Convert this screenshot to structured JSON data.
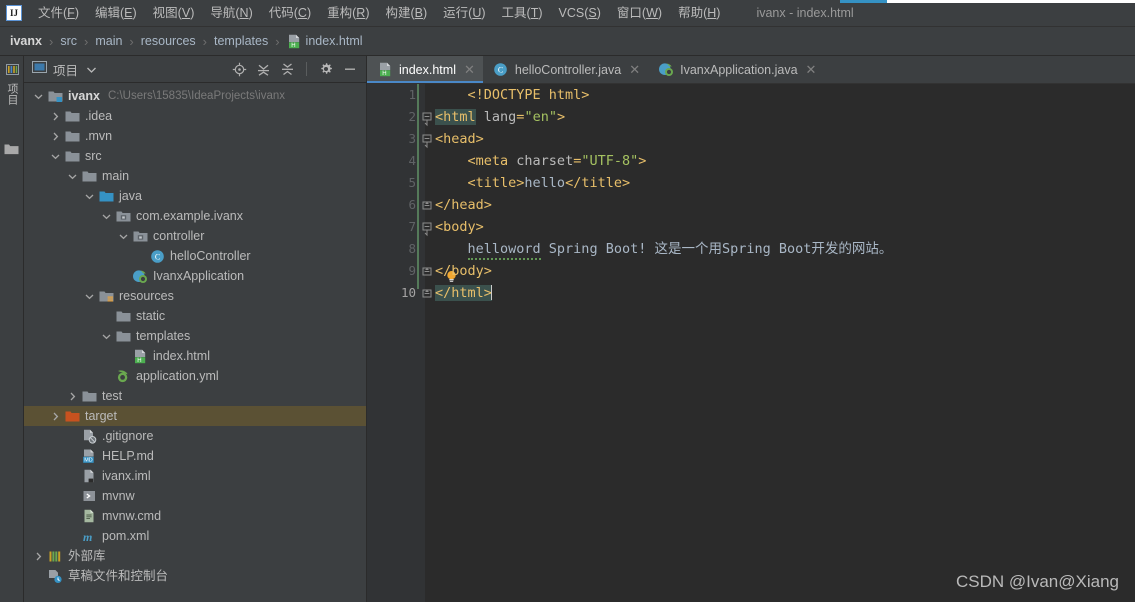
{
  "window": {
    "title": "ivanx - index.html",
    "logo_icon": "intellij-idea-logo-icon"
  },
  "menubar": {
    "items": [
      {
        "label": "文件",
        "mnemonic": "F"
      },
      {
        "label": "编辑",
        "mnemonic": "E"
      },
      {
        "label": "视图",
        "mnemonic": "V"
      },
      {
        "label": "导航",
        "mnemonic": "N"
      },
      {
        "label": "代码",
        "mnemonic": "C"
      },
      {
        "label": "重构",
        "mnemonic": "R"
      },
      {
        "label": "构建",
        "mnemonic": "B"
      },
      {
        "label": "运行",
        "mnemonic": "U"
      },
      {
        "label": "工具",
        "mnemonic": "T"
      },
      {
        "label": "VCS",
        "mnemonic": "S"
      },
      {
        "label": "窗口",
        "mnemonic": "W"
      },
      {
        "label": "帮助",
        "mnemonic": "H"
      }
    ]
  },
  "breadcrumb": {
    "separator": "›",
    "items": [
      {
        "label": "ivanx",
        "icon": ""
      },
      {
        "label": "src",
        "icon": ""
      },
      {
        "label": "main",
        "icon": ""
      },
      {
        "label": "resources",
        "icon": ""
      },
      {
        "label": "templates",
        "icon": ""
      },
      {
        "label": "index.html",
        "icon": "html-file-icon"
      }
    ]
  },
  "toolstrip": {
    "project_tab_label": "项目",
    "project_tab_icon": "project-tool-window-icon",
    "structure_icon": "folder-icon"
  },
  "project_panel": {
    "title": "项目",
    "title_icon": "project-icon",
    "caret_icon": "chevron-down-icon",
    "tools": [
      {
        "name": "locate-icon",
        "title": "选择打开的文件"
      },
      {
        "name": "expand-all-icon",
        "title": "全部展开"
      },
      {
        "name": "collapse-all-icon",
        "title": "全部折叠"
      },
      {
        "name": "settings-gear-icon",
        "title": "选项"
      },
      {
        "name": "minimize-icon",
        "title": "隐藏"
      }
    ],
    "tree": [
      {
        "label": "ivanx",
        "path": "C:\\Users\\15835\\IdeaProjects\\ivanx",
        "depth": 0,
        "arrow": "down",
        "icon": "module-folder-icon",
        "bold": true,
        "selected": false
      },
      {
        "label": ".idea",
        "path": "",
        "depth": 1,
        "arrow": "right",
        "icon": "folder-icon",
        "bold": false,
        "selected": false
      },
      {
        "label": ".mvn",
        "path": "",
        "depth": 1,
        "arrow": "right",
        "icon": "folder-icon",
        "bold": false,
        "selected": false
      },
      {
        "label": "src",
        "path": "",
        "depth": 1,
        "arrow": "down",
        "icon": "folder-icon",
        "bold": false,
        "selected": false
      },
      {
        "label": "main",
        "path": "",
        "depth": 2,
        "arrow": "down",
        "icon": "folder-icon",
        "bold": false,
        "selected": false
      },
      {
        "label": "java",
        "path": "",
        "depth": 3,
        "arrow": "down",
        "icon": "source-root-icon",
        "bold": false,
        "selected": false
      },
      {
        "label": "com.example.ivanx",
        "path": "",
        "depth": 4,
        "arrow": "down",
        "icon": "package-icon",
        "bold": false,
        "selected": false
      },
      {
        "label": "controller",
        "path": "",
        "depth": 5,
        "arrow": "down",
        "icon": "package-icon",
        "bold": false,
        "selected": false
      },
      {
        "label": "helloController",
        "path": "",
        "depth": 6,
        "arrow": "none",
        "icon": "java-class-icon",
        "bold": false,
        "selected": false
      },
      {
        "label": "IvanxApplication",
        "path": "",
        "depth": 5,
        "arrow": "none",
        "icon": "spring-boot-class-icon",
        "bold": false,
        "selected": false
      },
      {
        "label": "resources",
        "path": "",
        "depth": 3,
        "arrow": "down",
        "icon": "resource-root-icon",
        "bold": false,
        "selected": false
      },
      {
        "label": "static",
        "path": "",
        "depth": 4,
        "arrow": "none",
        "icon": "folder-icon",
        "bold": false,
        "selected": false
      },
      {
        "label": "templates",
        "path": "",
        "depth": 4,
        "arrow": "down",
        "icon": "folder-icon",
        "bold": false,
        "selected": false
      },
      {
        "label": "index.html",
        "path": "",
        "depth": 5,
        "arrow": "none",
        "icon": "html-file-icon",
        "bold": false,
        "selected": false
      },
      {
        "label": "application.yml",
        "path": "",
        "depth": 4,
        "arrow": "none",
        "icon": "spring-yaml-icon",
        "bold": false,
        "selected": false
      },
      {
        "label": "test",
        "path": "",
        "depth": 2,
        "arrow": "right",
        "icon": "folder-icon",
        "bold": false,
        "selected": false
      },
      {
        "label": "target",
        "path": "",
        "depth": 1,
        "arrow": "right",
        "icon": "excluded-folder-icon",
        "bold": false,
        "selected": true
      },
      {
        "label": ".gitignore",
        "path": "",
        "depth": 2,
        "arrow": "none",
        "icon": "gitignore-file-icon",
        "bold": false,
        "selected": false
      },
      {
        "label": "HELP.md",
        "path": "",
        "depth": 2,
        "arrow": "none",
        "icon": "markdown-file-icon",
        "bold": false,
        "selected": false
      },
      {
        "label": "ivanx.iml",
        "path": "",
        "depth": 2,
        "arrow": "none",
        "icon": "iml-file-icon",
        "bold": false,
        "selected": false
      },
      {
        "label": "mvnw",
        "path": "",
        "depth": 2,
        "arrow": "none",
        "icon": "shell-script-icon",
        "bold": false,
        "selected": false
      },
      {
        "label": "mvnw.cmd",
        "path": "",
        "depth": 2,
        "arrow": "none",
        "icon": "cmd-file-icon",
        "bold": false,
        "selected": false
      },
      {
        "label": "pom.xml",
        "path": "",
        "depth": 2,
        "arrow": "none",
        "icon": "maven-pom-icon",
        "bold": false,
        "selected": false
      },
      {
        "label": "外部库",
        "path": "",
        "depth": 0,
        "arrow": "right",
        "icon": "external-libraries-icon",
        "bold": false,
        "selected": false
      },
      {
        "label": "草稿文件和控制台",
        "path": "",
        "depth": 0,
        "arrow": "none",
        "icon": "scratches-consoles-icon",
        "bold": false,
        "selected": false
      }
    ]
  },
  "editor": {
    "tabs": [
      {
        "label": "index.html",
        "icon": "html-file-icon",
        "active": true,
        "close_icon": "close-icon"
      },
      {
        "label": "helloController.java",
        "icon": "java-class-icon",
        "active": false,
        "close_icon": "close-icon"
      },
      {
        "label": "IvanxApplication.java",
        "icon": "spring-boot-class-icon",
        "active": false,
        "close_icon": "close-icon"
      }
    ],
    "line_numbers": [
      "1",
      "2",
      "3",
      "4",
      "5",
      "6",
      "7",
      "8",
      "9",
      "10"
    ],
    "current_line": 10,
    "intention_bulb_icon": "lightbulb-icon",
    "lines": [
      {
        "n": 1,
        "fold": "",
        "segments": [
          {
            "t": "    ",
            "c": "txt"
          },
          {
            "t": "<!DOCTYPE html>",
            "c": "tag"
          }
        ]
      },
      {
        "n": 2,
        "fold": "open",
        "segments": [
          {
            "t": "<html",
            "c": "tag hl"
          },
          {
            "t": " ",
            "c": "txt"
          },
          {
            "t": "lang",
            "c": "attr"
          },
          {
            "t": "=",
            "c": "tag"
          },
          {
            "t": "\"en\"",
            "c": "str"
          },
          {
            "t": ">",
            "c": "tag"
          }
        ]
      },
      {
        "n": 3,
        "fold": "open",
        "segments": [
          {
            "t": "<head>",
            "c": "tag"
          }
        ]
      },
      {
        "n": 4,
        "fold": "",
        "segments": [
          {
            "t": "    ",
            "c": "txt"
          },
          {
            "t": "<meta",
            "c": "tag"
          },
          {
            "t": " ",
            "c": "txt"
          },
          {
            "t": "charset",
            "c": "attr"
          },
          {
            "t": "=",
            "c": "tag"
          },
          {
            "t": "\"UTF-8\"",
            "c": "str"
          },
          {
            "t": ">",
            "c": "tag"
          }
        ]
      },
      {
        "n": 5,
        "fold": "",
        "segments": [
          {
            "t": "    ",
            "c": "txt"
          },
          {
            "t": "<title>",
            "c": "tag"
          },
          {
            "t": "hello",
            "c": "txt"
          },
          {
            "t": "</title>",
            "c": "tag"
          }
        ]
      },
      {
        "n": 6,
        "fold": "close",
        "segments": [
          {
            "t": "</head>",
            "c": "tag"
          }
        ]
      },
      {
        "n": 7,
        "fold": "open",
        "segments": [
          {
            "t": "<body>",
            "c": "tag"
          }
        ]
      },
      {
        "n": 8,
        "fold": "",
        "segments": [
          {
            "t": "    ",
            "c": "txt"
          },
          {
            "t": "helloword",
            "c": "txt spell"
          },
          {
            "t": " Spring Boot! 这是一个用Spring Boot开发的网站。",
            "c": "txt"
          }
        ]
      },
      {
        "n": 9,
        "fold": "close",
        "segments": [
          {
            "t": "</body>",
            "c": "tag"
          }
        ]
      },
      {
        "n": 10,
        "fold": "close",
        "segments": [
          {
            "t": "</html>",
            "c": "tag hl"
          }
        ]
      }
    ]
  },
  "watermark": "CSDN @Ivan@Xiang",
  "colors": {
    "panel_bg": "#3c3f41",
    "editor_bg": "#2b2b2b",
    "gutter_bg": "#313335",
    "accent_blue": "#4a88c7",
    "selection_olive": "#5b5134",
    "tag_orange": "#e8bf6a",
    "string_green": "#a5c261",
    "text_gray": "#a9b7c6",
    "match_highlight": "#3b514d"
  }
}
